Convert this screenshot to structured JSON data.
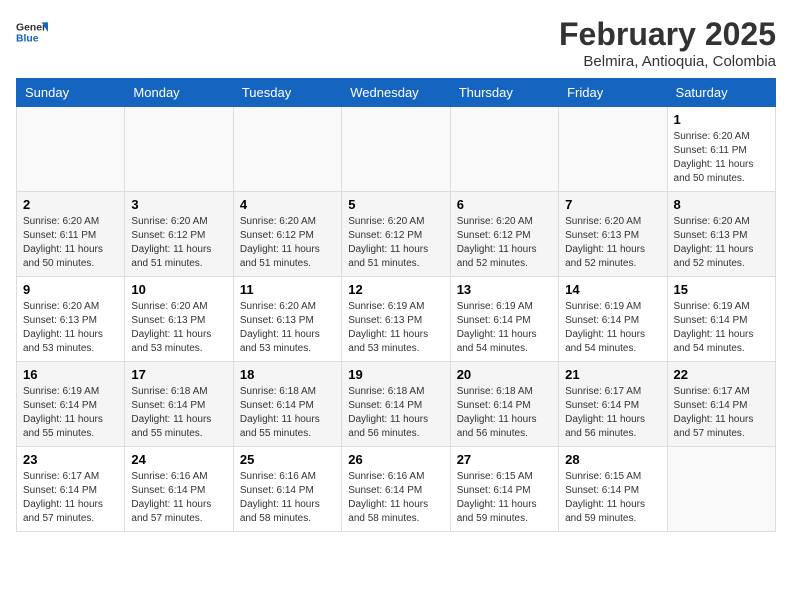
{
  "header": {
    "logo_general": "General",
    "logo_blue": "Blue",
    "title": "February 2025",
    "subtitle": "Belmira, Antioquia, Colombia"
  },
  "weekdays": [
    "Sunday",
    "Monday",
    "Tuesday",
    "Wednesday",
    "Thursday",
    "Friday",
    "Saturday"
  ],
  "weeks": [
    [
      {
        "day": null
      },
      {
        "day": null
      },
      {
        "day": null
      },
      {
        "day": null
      },
      {
        "day": null
      },
      {
        "day": null
      },
      {
        "day": 1,
        "sunrise": "6:20 AM",
        "sunset": "6:11 PM",
        "daylight": "11 hours and 50 minutes."
      }
    ],
    [
      {
        "day": 2,
        "sunrise": "6:20 AM",
        "sunset": "6:11 PM",
        "daylight": "11 hours and 50 minutes."
      },
      {
        "day": 3,
        "sunrise": "6:20 AM",
        "sunset": "6:12 PM",
        "daylight": "11 hours and 51 minutes."
      },
      {
        "day": 4,
        "sunrise": "6:20 AM",
        "sunset": "6:12 PM",
        "daylight": "11 hours and 51 minutes."
      },
      {
        "day": 5,
        "sunrise": "6:20 AM",
        "sunset": "6:12 PM",
        "daylight": "11 hours and 51 minutes."
      },
      {
        "day": 6,
        "sunrise": "6:20 AM",
        "sunset": "6:12 PM",
        "daylight": "11 hours and 52 minutes."
      },
      {
        "day": 7,
        "sunrise": "6:20 AM",
        "sunset": "6:13 PM",
        "daylight": "11 hours and 52 minutes."
      },
      {
        "day": 8,
        "sunrise": "6:20 AM",
        "sunset": "6:13 PM",
        "daylight": "11 hours and 52 minutes."
      }
    ],
    [
      {
        "day": 9,
        "sunrise": "6:20 AM",
        "sunset": "6:13 PM",
        "daylight": "11 hours and 53 minutes."
      },
      {
        "day": 10,
        "sunrise": "6:20 AM",
        "sunset": "6:13 PM",
        "daylight": "11 hours and 53 minutes."
      },
      {
        "day": 11,
        "sunrise": "6:20 AM",
        "sunset": "6:13 PM",
        "daylight": "11 hours and 53 minutes."
      },
      {
        "day": 12,
        "sunrise": "6:19 AM",
        "sunset": "6:13 PM",
        "daylight": "11 hours and 53 minutes."
      },
      {
        "day": 13,
        "sunrise": "6:19 AM",
        "sunset": "6:14 PM",
        "daylight": "11 hours and 54 minutes."
      },
      {
        "day": 14,
        "sunrise": "6:19 AM",
        "sunset": "6:14 PM",
        "daylight": "11 hours and 54 minutes."
      },
      {
        "day": 15,
        "sunrise": "6:19 AM",
        "sunset": "6:14 PM",
        "daylight": "11 hours and 54 minutes."
      }
    ],
    [
      {
        "day": 16,
        "sunrise": "6:19 AM",
        "sunset": "6:14 PM",
        "daylight": "11 hours and 55 minutes."
      },
      {
        "day": 17,
        "sunrise": "6:18 AM",
        "sunset": "6:14 PM",
        "daylight": "11 hours and 55 minutes."
      },
      {
        "day": 18,
        "sunrise": "6:18 AM",
        "sunset": "6:14 PM",
        "daylight": "11 hours and 55 minutes."
      },
      {
        "day": 19,
        "sunrise": "6:18 AM",
        "sunset": "6:14 PM",
        "daylight": "11 hours and 56 minutes."
      },
      {
        "day": 20,
        "sunrise": "6:18 AM",
        "sunset": "6:14 PM",
        "daylight": "11 hours and 56 minutes."
      },
      {
        "day": 21,
        "sunrise": "6:17 AM",
        "sunset": "6:14 PM",
        "daylight": "11 hours and 56 minutes."
      },
      {
        "day": 22,
        "sunrise": "6:17 AM",
        "sunset": "6:14 PM",
        "daylight": "11 hours and 57 minutes."
      }
    ],
    [
      {
        "day": 23,
        "sunrise": "6:17 AM",
        "sunset": "6:14 PM",
        "daylight": "11 hours and 57 minutes."
      },
      {
        "day": 24,
        "sunrise": "6:16 AM",
        "sunset": "6:14 PM",
        "daylight": "11 hours and 57 minutes."
      },
      {
        "day": 25,
        "sunrise": "6:16 AM",
        "sunset": "6:14 PM",
        "daylight": "11 hours and 58 minutes."
      },
      {
        "day": 26,
        "sunrise": "6:16 AM",
        "sunset": "6:14 PM",
        "daylight": "11 hours and 58 minutes."
      },
      {
        "day": 27,
        "sunrise": "6:15 AM",
        "sunset": "6:14 PM",
        "daylight": "11 hours and 59 minutes."
      },
      {
        "day": 28,
        "sunrise": "6:15 AM",
        "sunset": "6:14 PM",
        "daylight": "11 hours and 59 minutes."
      },
      {
        "day": null
      }
    ]
  ]
}
